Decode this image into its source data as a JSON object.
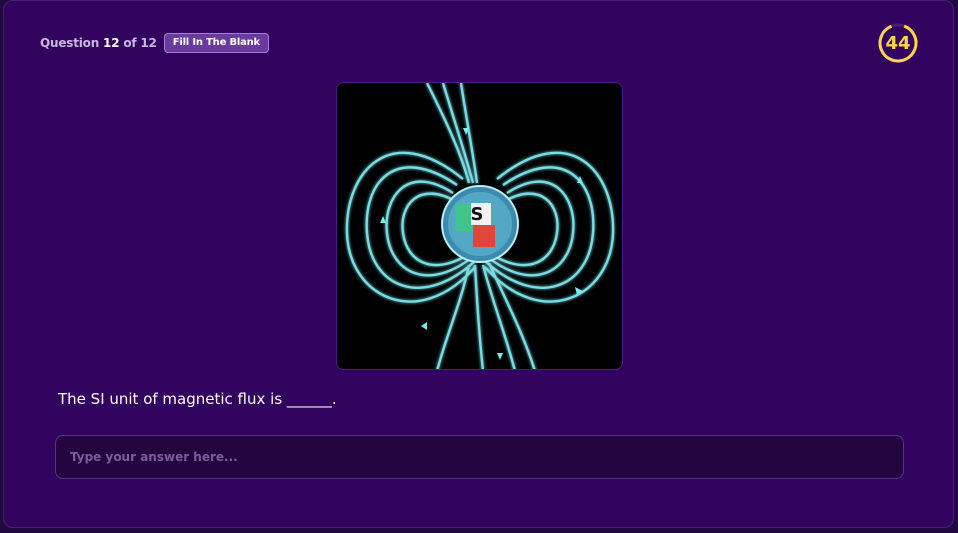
{
  "header": {
    "question_label": "Question",
    "question_current": "12",
    "question_of": "of",
    "question_total": "12",
    "question_type": "Fill In The Blank"
  },
  "timer": {
    "value": "44",
    "color": "#ffd54a"
  },
  "question": {
    "image_icon": "magnet-field-lines-image",
    "magnet_pole_label": "S",
    "text": "The SI unit of magnetic flux is ______."
  },
  "answer": {
    "value": "",
    "placeholder": "Type your answer here..."
  },
  "colors": {
    "background": "#32035e",
    "accent": "#ffd54a",
    "badge": "#6a3a9e"
  }
}
